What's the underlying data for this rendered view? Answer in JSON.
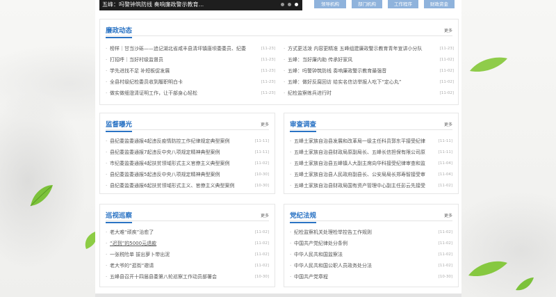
{
  "banner": {
    "caption": "五峰：吗警钟筑防线 奏响廉政警示教育...",
    "dots": [
      false,
      false,
      true
    ]
  },
  "quick_links": [
    "领导机构",
    "部门机构",
    "工作程序",
    "财政资金"
  ],
  "lianzheng": {
    "title": "廉政动态",
    "more": "更多",
    "left": [
      {
        "t": "榜样｜甘当沙砾——追记湖北省咸丰县清坪镇唐坝委委员、纪委",
        "d": "[11-23]"
      },
      {
        "t": "打招呼｜当好村级监督员",
        "d": "[11-23]"
      },
      {
        "t": "学先进找不足 补短板促发展",
        "d": "[11-23]"
      },
      {
        "t": "全县村级纪检委员收到履职明白卡",
        "d": "[11-23]"
      },
      {
        "t": "做实做细澄清证明工作，让干部身心轻松",
        "d": "[11-23]"
      }
    ],
    "right": [
      {
        "t": "方式更活泼 内容更精准 五峰组建廉政警示教育青年宣讲小分队",
        "d": "[11-23]"
      },
      {
        "t": "五峰：当好廉内助 传承好家风",
        "d": "[11-02]"
      },
      {
        "t": "五峰：吗警钟筑防线 奏响廉政警示教育最强音",
        "d": "[11-02]"
      },
      {
        "t": "五峰：做好反腐回访 给实名信访举报人吃下“定心丸”",
        "d": "[11-02]"
      },
      {
        "t": "纪检监察练兵进行时",
        "d": "[11-02]"
      }
    ]
  },
  "jiandu": {
    "title": "监督曝光",
    "more": "更多",
    "items": [
      {
        "t": "县纪委监委通报4起违反疫情防控工作纪律规定典型案例",
        "d": "[11-11]"
      },
      {
        "t": "县纪委监委通报7起违反中央八项规定精神典型案例",
        "d": "[11-11]"
      },
      {
        "t": "市纪委监委通报4起扶贫领域形式主义官僚主义典型案例",
        "d": "[11-02]"
      },
      {
        "t": "县纪委监委通报5起违反中央八项规定精神典型案例",
        "d": "[10-30]"
      },
      {
        "t": "县纪委监委通报6起扶贫领域形式主义、官僚主义典型案例",
        "d": "[10-30]"
      }
    ]
  },
  "shencha": {
    "title": "审查调查",
    "more": "更多",
    "items": [
      {
        "t": "五峰土家族自治县发展和改革局一级主任科员郭东平接受纪律",
        "d": "[11-11]"
      },
      {
        "t": "五峰土家族自治县财政局原副局长、五峰长信担保有限公司原",
        "d": "[11-11]"
      },
      {
        "t": "五峰土家族自治县五峰镇人大副主席向华科接受纪律审查和监",
        "d": "[11-04]"
      },
      {
        "t": "五峰土家族自治县人民政府副县长、公安局局长郑寿智接受审",
        "d": "[11-04]"
      },
      {
        "t": "五峰土家族自治县财政局国有资产管理中心副主任彭云先接受",
        "d": "[11-02]"
      }
    ]
  },
  "xunshi": {
    "title": "巡视巡察",
    "more": "更多",
    "items": [
      {
        "t": "老大难“顽疾”治愈了",
        "d": "[11-02]",
        "u": false
      },
      {
        "t": "“迟到”的5000元退款",
        "d": "[11-02]",
        "u": true
      },
      {
        "t": "一张税险单 拔出萝卜带出泥",
        "d": "[11-02]",
        "u": false
      },
      {
        "t": "老大爷的“逛街”邀请",
        "d": "[11-02]",
        "u": false
      },
      {
        "t": "五峰县召开十四届县委第八轮巡察工作动员部署会",
        "d": "[10-30]",
        "u": false
      }
    ]
  },
  "dangji": {
    "title": "党纪法规",
    "more": "更多",
    "items": [
      {
        "t": "纪检监察机关处理检举控告工作规则",
        "d": "[11-02]"
      },
      {
        "t": "中国共产党纪律处分条例",
        "d": "[11-02]"
      },
      {
        "t": "中华人民共和国监察法",
        "d": "[11-02]"
      },
      {
        "t": "中华人民共和国公职人员政务处分法",
        "d": "[11-02]"
      },
      {
        "t": "中国共产党章程",
        "d": "[10-30]"
      }
    ]
  },
  "colors": {
    "accent": "#2a73c4",
    "quick_link": "#8fb3dc",
    "leaf": "#7cc23a"
  }
}
